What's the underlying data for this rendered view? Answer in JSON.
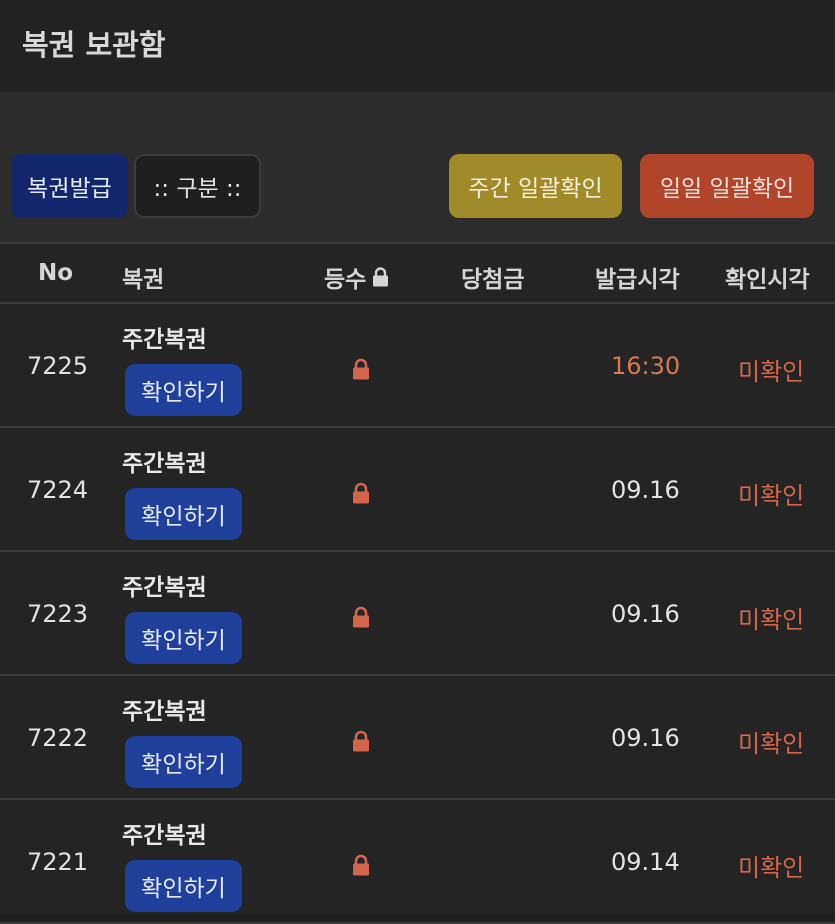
{
  "header": {
    "title": "복권 보관함"
  },
  "toolbar": {
    "issue_label": "복권발급",
    "category_label": ":: 구분 ::",
    "weekly_confirm_label": "주간 일괄확인",
    "daily_confirm_label": "일일 일괄확인"
  },
  "colors": {
    "issue_button": "#13256b",
    "weekly_button": "#a18a2a",
    "daily_button": "#b0452b",
    "check_button": "#1e3f9a",
    "lock_icon": "#d4654d",
    "unchecked_text": "#d4654d"
  },
  "table": {
    "headers": {
      "no": "No",
      "ticket": "복권",
      "rank": "등수",
      "prize": "당첨금",
      "issued": "발급시각",
      "checked": "확인시각"
    },
    "rank_header_icon": "lock-icon",
    "rows": [
      {
        "no": "7225",
        "ticket": "주간복권",
        "button": "확인하기",
        "rank_icon": "lock-icon",
        "prize": "",
        "issued": "16:30",
        "checked": "미확인"
      },
      {
        "no": "7224",
        "ticket": "주간복권",
        "button": "확인하기",
        "rank_icon": "lock-icon",
        "prize": "",
        "issued": "09.16",
        "checked": "미확인"
      },
      {
        "no": "7223",
        "ticket": "주간복권",
        "button": "확인하기",
        "rank_icon": "lock-icon",
        "prize": "",
        "issued": "09.16",
        "checked": "미확인"
      },
      {
        "no": "7222",
        "ticket": "주간복권",
        "button": "확인하기",
        "rank_icon": "lock-icon",
        "prize": "",
        "issued": "09.16",
        "checked": "미확인"
      },
      {
        "no": "7221",
        "ticket": "주간복권",
        "button": "확인하기",
        "rank_icon": "lock-icon",
        "prize": "",
        "issued": "09.14",
        "checked": "미확인"
      }
    ]
  }
}
